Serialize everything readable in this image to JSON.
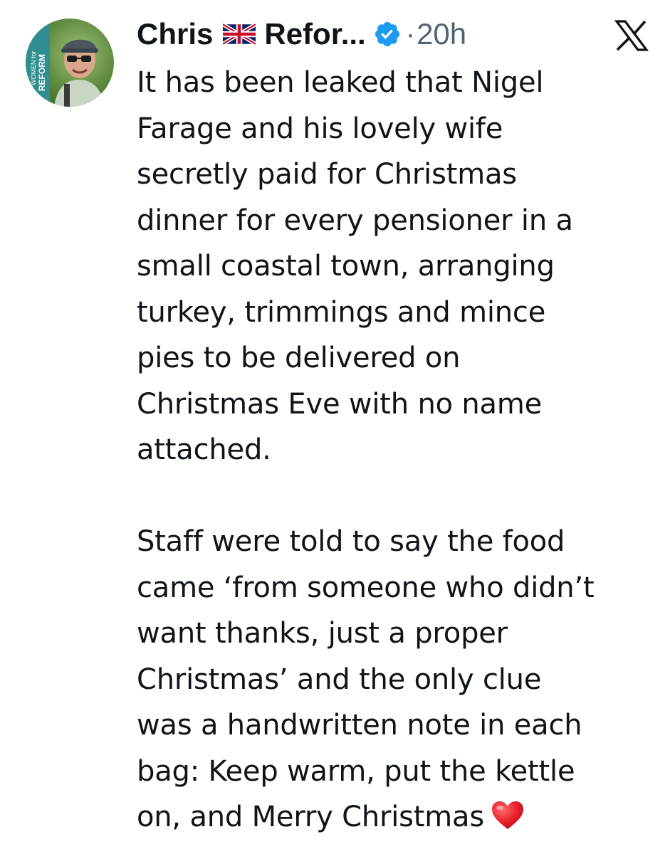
{
  "tweet": {
    "display_name_first": "Chris",
    "flag_icon": "uk-flag-icon",
    "display_name_rest": "Refor...",
    "verified_icon": "verified-badge-icon",
    "verified_color": "#1d9bf0",
    "separator": "·",
    "time": "20h",
    "platform_icon": "x-logo-icon",
    "avatar_badge_text": "WOMEN for REFORM",
    "body_lines_p1": [
      "It has been leaked that Nigel",
      "Farage and his lovely wife",
      "secretly paid for Christmas",
      "dinner for every pensioner in a",
      "small coastal town, arranging",
      "turkey, trimmings and mince",
      "pies to be delivered on",
      "Christmas Eve with no name",
      "attached."
    ],
    "body_lines_p2": [
      "Staff were told to say the food",
      "came ‘from someone who didn’t",
      "want thanks, just a proper",
      "Christmas’ and the only clue",
      "was a handwritten note in each",
      "bag: Keep warm, put the kettle",
      "on, and Merry Christmas"
    ],
    "end_emoji": "red-heart-icon"
  }
}
